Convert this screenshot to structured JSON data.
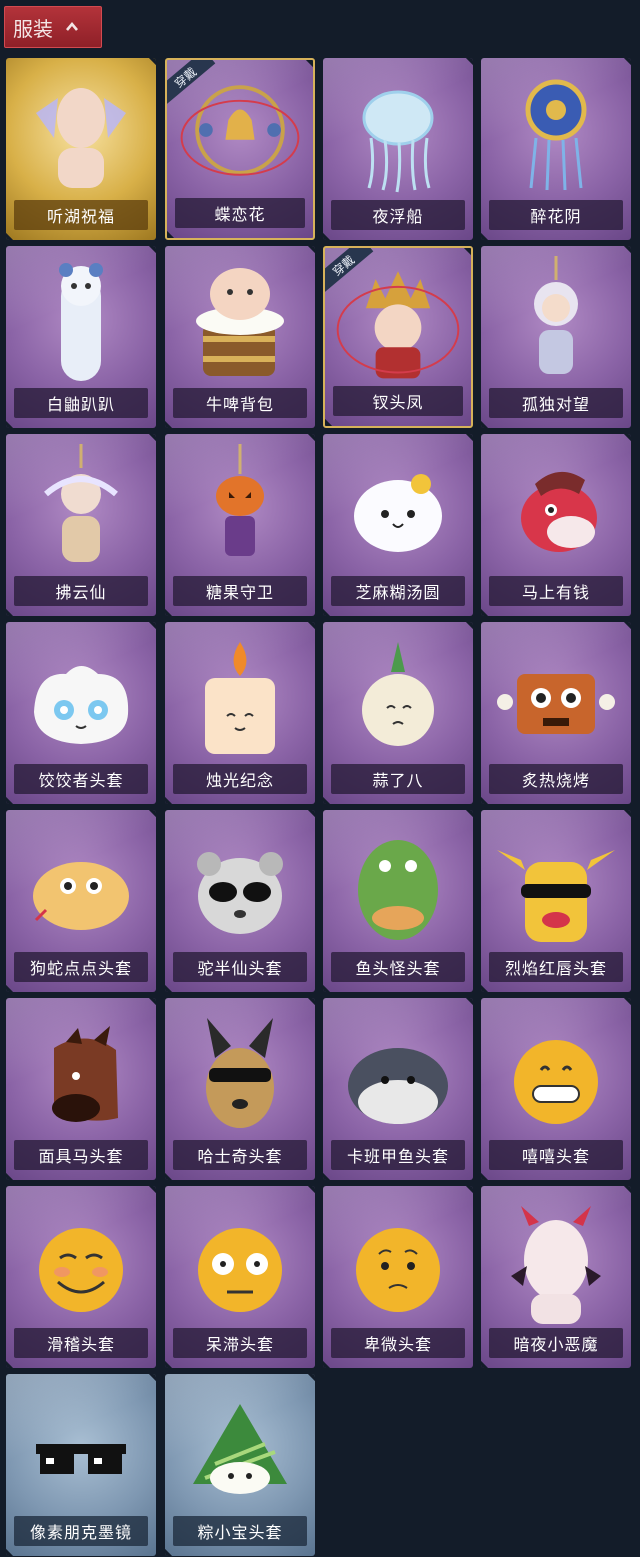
{
  "header": {
    "title": "服装",
    "toggle_icon": "chevron-up-icon"
  },
  "colors": {
    "background": "#131c29",
    "tab": "#a32a31",
    "equipped_border": "#d6b25a"
  },
  "equipped_badge": "穿戴",
  "items": [
    {
      "name": "听湖祝福",
      "rarity": "gold",
      "icon": "angel-figure-icon",
      "equipped": false
    },
    {
      "name": "蝶恋花",
      "rarity": "purple",
      "icon": "bell-wreath-icon",
      "equipped": true
    },
    {
      "name": "夜浮船",
      "rarity": "purple",
      "icon": "jellyfish-icon",
      "equipped": false
    },
    {
      "name": "醉花阴",
      "rarity": "purple",
      "icon": "ornate-pendant-icon",
      "equipped": false
    },
    {
      "name": "白鼬趴趴",
      "rarity": "purple",
      "icon": "white-ferret-icon",
      "equipped": false
    },
    {
      "name": "牛啤背包",
      "rarity": "purple",
      "icon": "cow-beer-mug-icon",
      "equipped": false
    },
    {
      "name": "钗头凤",
      "rarity": "purple",
      "icon": "phoenix-crown-doll-icon",
      "equipped": true
    },
    {
      "name": "孤独对望",
      "rarity": "purple",
      "icon": "doll-charm-icon",
      "equipped": false
    },
    {
      "name": "拂云仙",
      "rarity": "purple",
      "icon": "fairy-charm-icon",
      "equipped": false
    },
    {
      "name": "糖果守卫",
      "rarity": "purple",
      "icon": "pumpkin-charm-icon",
      "equipped": false
    },
    {
      "name": "芝麻糊汤圆",
      "rarity": "purple",
      "icon": "rice-ball-icon",
      "equipped": false
    },
    {
      "name": "马上有钱",
      "rarity": "purple",
      "icon": "red-horse-icon",
      "equipped": false
    },
    {
      "name": "饺饺者头套",
      "rarity": "purple",
      "icon": "dumpling-head-icon",
      "equipped": false
    },
    {
      "name": "烛光纪念",
      "rarity": "purple",
      "icon": "candle-head-icon",
      "equipped": false
    },
    {
      "name": "蒜了八",
      "rarity": "purple",
      "icon": "garlic-head-icon",
      "equipped": false
    },
    {
      "name": "炙热烧烤",
      "rarity": "purple",
      "icon": "meat-bone-head-icon",
      "equipped": false
    },
    {
      "name": "狗蛇点点头套",
      "rarity": "purple",
      "icon": "snake-head-icon",
      "equipped": false
    },
    {
      "name": "驼半仙头套",
      "rarity": "purple",
      "icon": "raccoon-sunglasses-icon",
      "equipped": false
    },
    {
      "name": "鱼头怪头套",
      "rarity": "purple",
      "icon": "fish-head-icon",
      "equipped": false
    },
    {
      "name": "烈焰红唇头套",
      "rarity": "purple",
      "icon": "pikachu-mask-icon",
      "equipped": false
    },
    {
      "name": "面具马头套",
      "rarity": "purple",
      "icon": "horse-mask-icon",
      "equipped": false
    },
    {
      "name": "哈士奇头套",
      "rarity": "purple",
      "icon": "husky-mask-icon",
      "equipped": false
    },
    {
      "name": "卡班甲鱼头套",
      "rarity": "purple",
      "icon": "seal-head-icon",
      "equipped": false
    },
    {
      "name": "嘻嘻头套",
      "rarity": "purple",
      "icon": "grin-emoji-icon",
      "equipped": false
    },
    {
      "name": "滑稽头套",
      "rarity": "purple",
      "icon": "smirk-emoji-icon",
      "equipped": false
    },
    {
      "name": "呆滞头套",
      "rarity": "purple",
      "icon": "stare-emoji-icon",
      "equipped": false
    },
    {
      "name": "卑微头套",
      "rarity": "purple",
      "icon": "humble-emoji-icon",
      "equipped": false
    },
    {
      "name": "暗夜小恶魔",
      "rarity": "purple",
      "icon": "devil-head-icon",
      "equipped": false
    },
    {
      "name": "像素朋克墨镜",
      "rarity": "blue",
      "icon": "pixel-sunglasses-icon",
      "equipped": false
    },
    {
      "name": "粽小宝头套",
      "rarity": "blue",
      "icon": "zongzi-head-icon",
      "equipped": false
    }
  ]
}
